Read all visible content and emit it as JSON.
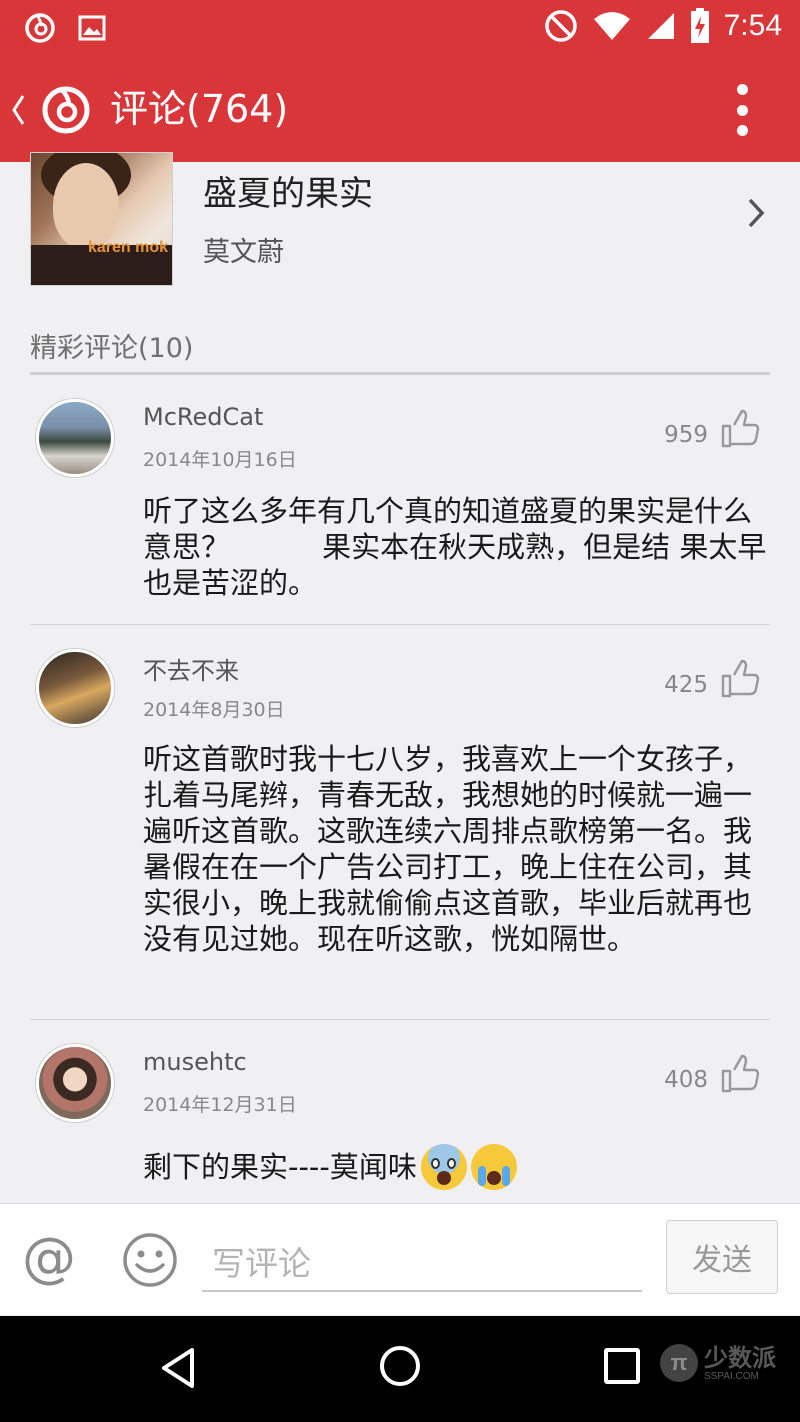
{
  "status_bar": {
    "time": "7:54"
  },
  "app_bar": {
    "title": "评论(764)"
  },
  "song": {
    "title": "盛夏的果实",
    "artist": "莫文蔚",
    "cover_brand": "karen mok"
  },
  "section": {
    "title": "精彩评论(10)"
  },
  "comments": [
    {
      "username": "McRedCat",
      "date": "2014年10月16日",
      "likes": "959",
      "text": "听了这么多年有几个真的知道盛夏的果实是什么意思？          果实本在秋天成熟，但是结 果太早也是苦涩的。"
    },
    {
      "username": "不去不来",
      "date": "2014年8月30日",
      "likes": "425",
      "text": "听这首歌时我十七八岁，我喜欢上一个女孩子，扎着马尾辫，青春无敌，我想她的时候就一遍一遍听这首歌。这歌连续六周排点歌榜第一名。我暑假在在一个广告公司打工，晚上住在公司，其实很小，晚上我就偷偷点这首歌，毕业后就再也没有见过她。现在听这歌，恍如隔世。"
    },
    {
      "username": "musehtc",
      "date": "2014年12月31日",
      "likes": "408",
      "text": "剩下的果实----莫闻味"
    }
  ],
  "input_bar": {
    "at_symbol": "@",
    "placeholder": "写评论",
    "value": "",
    "send_label": "发送"
  },
  "watermark": {
    "logo": "π",
    "name": "少数派",
    "domain": "SSPAI.COM"
  },
  "colors": {
    "brand_red": "#d9363a",
    "background": "#f0f0f2"
  }
}
